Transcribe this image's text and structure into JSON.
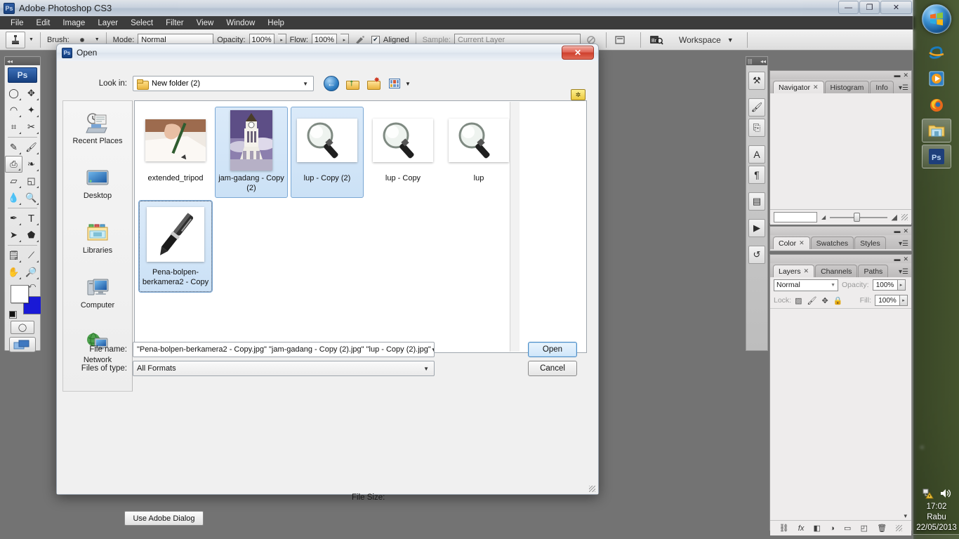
{
  "app": {
    "title": "Adobe Photoshop CS3",
    "logo_text": "Ps",
    "menu": [
      "File",
      "Edit",
      "Image",
      "Layer",
      "Select",
      "Filter",
      "View",
      "Window",
      "Help"
    ],
    "window_controls": {
      "minimize": "—",
      "restore": "❐",
      "close": "✕"
    }
  },
  "options_bar": {
    "tool_icon": "clone-stamp-icon",
    "brush_label": "Brush:",
    "brush_value": "",
    "mode_label": "Mode:",
    "mode_value": "Normal",
    "opacity_label": "Opacity:",
    "opacity_value": "100%",
    "flow_label": "Flow:",
    "flow_value": "100%",
    "airbrush_icon": "airbrush-icon",
    "aligned_label": "Aligned",
    "aligned_checked": "✔",
    "sample_label": "Sample:",
    "sample_value": "Current Layer",
    "ignore_adjustment_icon": "ignore-adjustment-layers-icon",
    "clone_source_icon": "clone-source-panel-icon",
    "bridge_icon": "bridge-icon",
    "workspace_label": "Workspace"
  },
  "toolbox": {
    "logo_text": "Ps",
    "tools": [
      {
        "name": "marquee-tool",
        "glyph": "◯"
      },
      {
        "name": "move-tool",
        "glyph": "✥"
      },
      {
        "name": "lasso-tool",
        "glyph": "◠"
      },
      {
        "name": "magic-wand-tool",
        "glyph": "✦"
      },
      {
        "name": "crop-tool",
        "glyph": "⌗"
      },
      {
        "name": "slice-tool",
        "glyph": "✂"
      },
      {
        "name": "healing-brush-tool",
        "glyph": "✎"
      },
      {
        "name": "brush-tool",
        "glyph": "🖌"
      },
      {
        "name": "clone-stamp-tool",
        "glyph": "⎙"
      },
      {
        "name": "history-brush-tool",
        "glyph": "❧"
      },
      {
        "name": "eraser-tool",
        "glyph": "▱"
      },
      {
        "name": "gradient-tool",
        "glyph": "◱"
      },
      {
        "name": "blur-tool",
        "glyph": "💧"
      },
      {
        "name": "dodge-tool",
        "glyph": "🔍"
      },
      {
        "name": "pen-tool",
        "glyph": "✒"
      },
      {
        "name": "type-tool",
        "glyph": "T"
      },
      {
        "name": "path-selection-tool",
        "glyph": "➤"
      },
      {
        "name": "shape-tool",
        "glyph": "⬟"
      },
      {
        "name": "notes-tool",
        "glyph": "🗒"
      },
      {
        "name": "eyedropper-tool",
        "glyph": "⟋"
      },
      {
        "name": "hand-tool",
        "glyph": "✋"
      },
      {
        "name": "zoom-tool",
        "glyph": "🔎"
      }
    ],
    "selected_tool": "clone-stamp-tool",
    "foreground_color": "#ffffff",
    "background_color": "#1919d6",
    "quickmask_glyph": "◯",
    "screenmode_glyph": "▤"
  },
  "icon_dock": {
    "items": [
      {
        "name": "tool-presets-icon",
        "glyph": "⚒"
      },
      {
        "name": "brushes-icon",
        "glyph": "🖌"
      },
      {
        "name": "clone-source-icon",
        "glyph": "⎘"
      },
      {
        "name": "character-icon",
        "glyph": "A"
      },
      {
        "name": "paragraph-icon",
        "glyph": "¶"
      },
      {
        "name": "layer-comps-icon",
        "glyph": "▤"
      },
      {
        "name": "animation-icon",
        "glyph": "▶"
      },
      {
        "name": "history-icon",
        "glyph": "↺"
      }
    ]
  },
  "panels": {
    "navigator": {
      "tabs": [
        "Navigator",
        "Histogram",
        "Info"
      ],
      "active_tab": "Navigator",
      "zoom_value": "",
      "zoom_out_icon": "small-mountain-icon",
      "zoom_in_icon": "large-mountain-icon"
    },
    "color": {
      "tabs": [
        "Color",
        "Swatches",
        "Styles"
      ],
      "active_tab": "Color"
    },
    "layers": {
      "tabs": [
        "Layers",
        "Channels",
        "Paths"
      ],
      "active_tab": "Layers",
      "blend_mode": "Normal",
      "opacity_label": "Opacity:",
      "opacity_value": "100%",
      "lock_label": "Lock:",
      "fill_label": "Fill:",
      "fill_value": "100%",
      "lock_icons": [
        {
          "name": "lock-transparent-pixels-icon",
          "glyph": "▨"
        },
        {
          "name": "lock-image-pixels-icon",
          "glyph": "🖌"
        },
        {
          "name": "lock-position-icon",
          "glyph": "✥"
        },
        {
          "name": "lock-all-icon",
          "glyph": "🔒"
        }
      ],
      "footer_icons": [
        {
          "name": "link-layers-icon",
          "glyph": "⛓"
        },
        {
          "name": "layer-style-icon",
          "glyph": "fx"
        },
        {
          "name": "layer-mask-icon",
          "glyph": "◧"
        },
        {
          "name": "adjustment-layer-icon",
          "glyph": "◑"
        },
        {
          "name": "new-group-icon",
          "glyph": "▭"
        },
        {
          "name": "new-layer-icon",
          "glyph": "◰"
        },
        {
          "name": "delete-layer-icon",
          "glyph": "🗑"
        }
      ]
    }
  },
  "dialog": {
    "title": "Open",
    "logo_text": "Ps",
    "close_label": "✕",
    "look_in_label": "Look in:",
    "look_in_value": "New folder (2)",
    "toolbar_icons": [
      {
        "name": "back-button",
        "glyph": "←"
      },
      {
        "name": "up-one-level-button",
        "glyph": "folder-up"
      },
      {
        "name": "create-new-folder-button",
        "glyph": "folder-new"
      },
      {
        "name": "views-button",
        "glyph": "view-grid"
      }
    ],
    "right_toolbar_icon": {
      "name": "toggle-preview-button",
      "glyph": "✲"
    },
    "places": [
      {
        "name": "recent-places",
        "label": "Recent Places"
      },
      {
        "name": "desktop",
        "label": "Desktop"
      },
      {
        "name": "libraries",
        "label": "Libraries"
      },
      {
        "name": "computer",
        "label": "Computer"
      },
      {
        "name": "network",
        "label": "Network"
      }
    ],
    "files": [
      {
        "label": "extended_tripod",
        "thumb": "pencil-hand",
        "state": "normal"
      },
      {
        "label": "jam-gadang - Copy (2)",
        "thumb": "clock-tower",
        "state": "selected"
      },
      {
        "label": "lup - Copy (2)",
        "thumb": "magnifier",
        "state": "selected"
      },
      {
        "label": "lup - Copy",
        "thumb": "magnifier",
        "state": "normal"
      },
      {
        "label": "lup",
        "thumb": "magnifier",
        "state": "normal"
      },
      {
        "label": "Pena-bolpen-berkamera2 - Copy",
        "thumb": "pen",
        "state": "focused"
      }
    ],
    "file_name_label": "File name:",
    "file_name_value": "\"Pena-bolpen-berkamera2 - Copy.jpg\" \"jam-gadang - Copy (2).jpg\" \"lup - Copy (2).jpg\"",
    "files_of_type_label": "Files of type:",
    "files_of_type_value": "All Formats",
    "open_button": "Open",
    "cancel_button": "Cancel",
    "file_size_label": "File Size:",
    "use_adobe_dialog_button": "Use Adobe Dialog"
  },
  "taskbar": {
    "start_label": "start-orb",
    "items": [
      {
        "name": "internet-explorer-icon",
        "glyph": "e",
        "pinned": false
      },
      {
        "name": "windows-media-player-icon",
        "glyph": "▶",
        "pinned": false
      },
      {
        "name": "firefox-icon",
        "glyph": "🦊",
        "pinned": false
      },
      {
        "name": "windows-explorer-icon",
        "glyph": "📁",
        "pinned": true
      },
      {
        "name": "photoshop-taskbar-icon",
        "glyph": "Ps",
        "pinned": true
      }
    ],
    "tray": {
      "network_icon": "network-warning-icon",
      "volume_icon": "volume-icon",
      "time": "17:02",
      "day": "Rabu",
      "date": "22/05/2013"
    }
  },
  "colors": {
    "ps_blue": "#133f80",
    "selection_blue": "#cbe1f6",
    "selection_border": "#7aa7d4",
    "close_red": "#cf3f2d",
    "background_swatch": "#1919d6"
  }
}
